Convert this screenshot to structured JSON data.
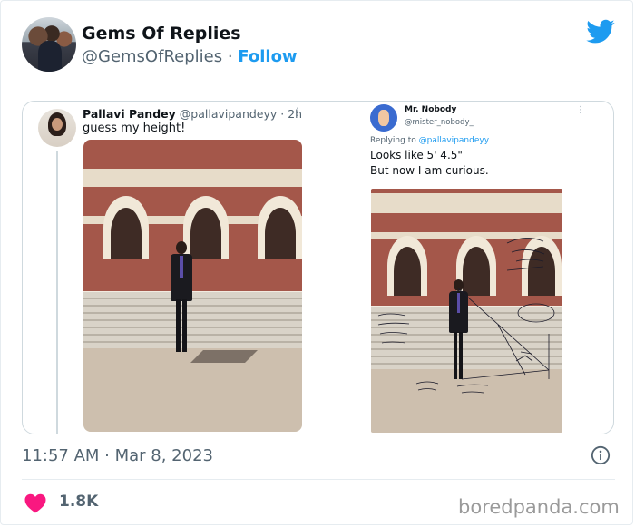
{
  "header": {
    "account_name": "Gems Of Replies",
    "handle": "@GemsOfReplies",
    "separator": "·",
    "follow_label": "Follow"
  },
  "embedded": {
    "left_tweet": {
      "display_name": "Pallavi Pandey",
      "meta": "@pallavipandeyy · 2h",
      "more": "⋮",
      "text": "guess my height!"
    },
    "right_tweet": {
      "display_name": "Mr. Nobody",
      "handle": "@mister_nobody_",
      "more": "⋮",
      "replying_prefix": "Replying to ",
      "replying_handle": "@pallavipandeyy",
      "text_line1": "Looks like 5' 4.5\"",
      "text_line2": "But now I am curious."
    }
  },
  "footer": {
    "timestamp": "11:57 AM · Mar 8, 2023",
    "likes": "1.8K",
    "watermark": "boredpanda.com"
  },
  "colors": {
    "accent": "#1d9bf0",
    "heart": "#f91880",
    "muted": "#536471"
  }
}
